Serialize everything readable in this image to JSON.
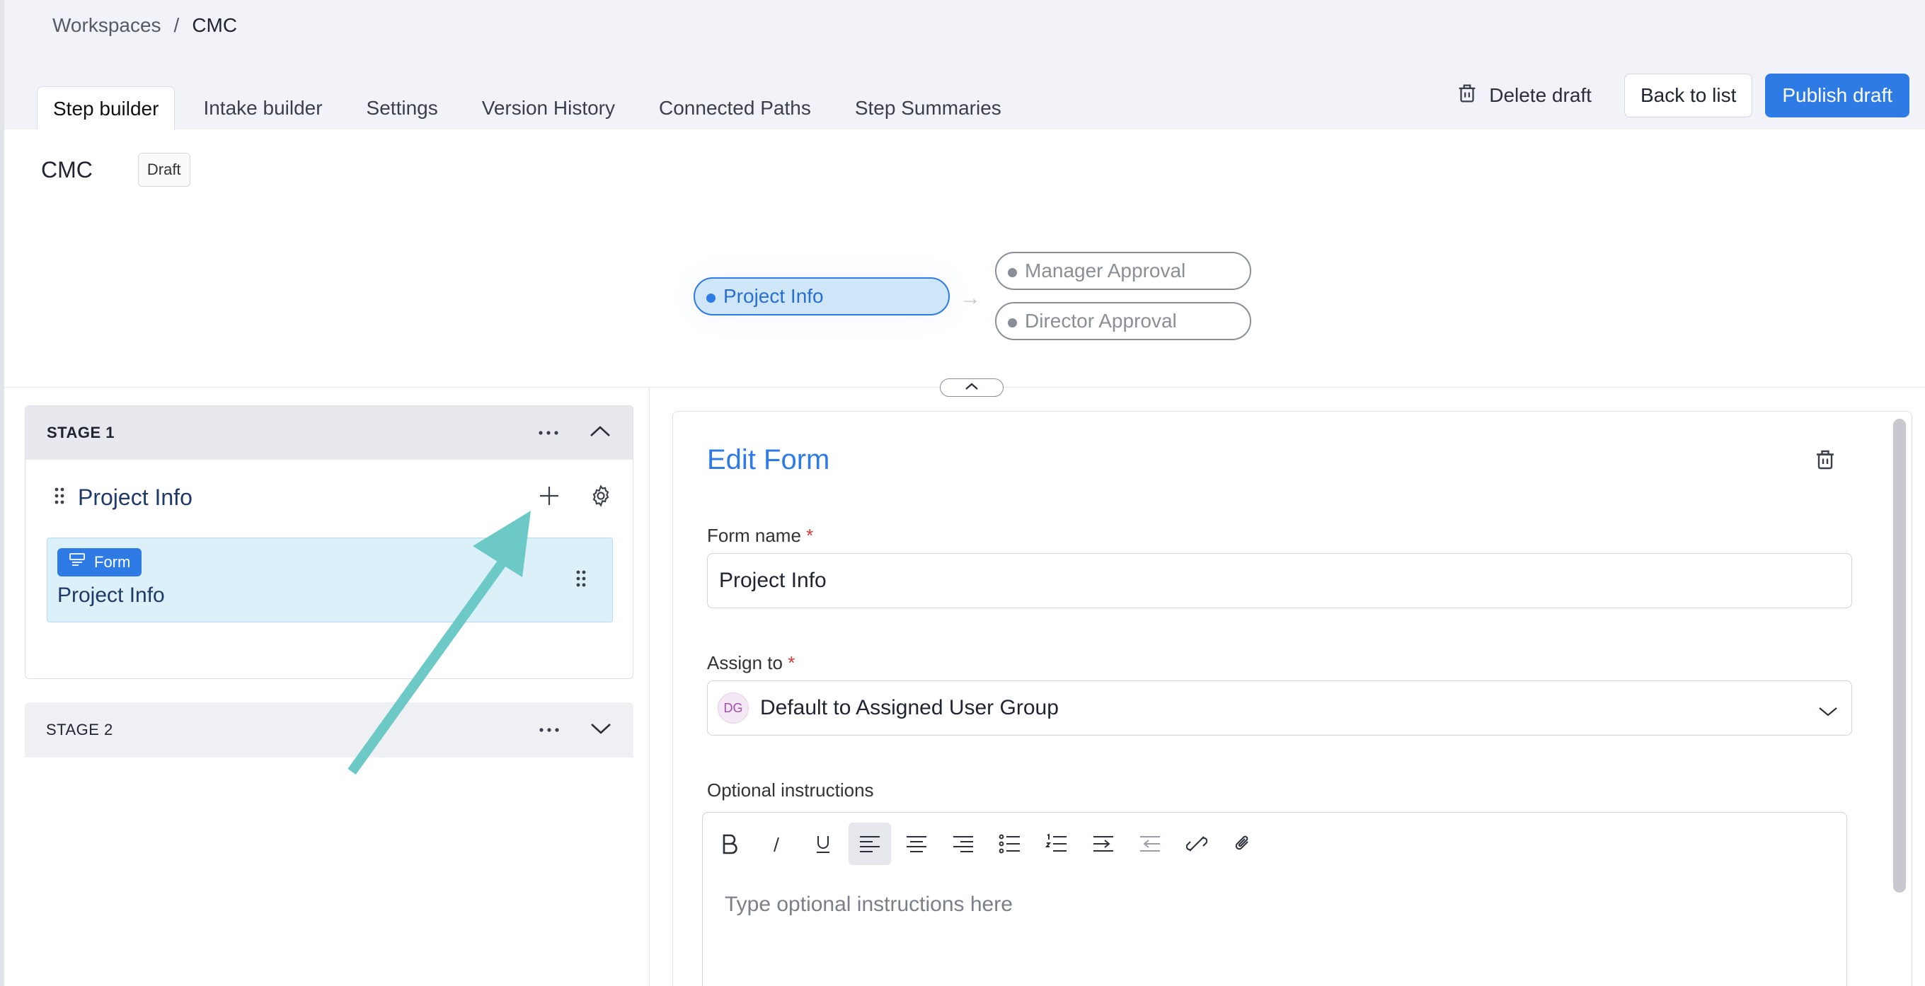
{
  "breadcrumb": {
    "root": "Workspaces",
    "separator": "/",
    "current": "CMC"
  },
  "tabs": [
    {
      "label": "Step builder",
      "active": true
    },
    {
      "label": "Intake builder",
      "active": false
    },
    {
      "label": "Settings",
      "active": false
    },
    {
      "label": "Version History",
      "active": false
    },
    {
      "label": "Connected Paths",
      "active": false
    },
    {
      "label": "Step Summaries",
      "active": false
    }
  ],
  "actions": {
    "delete_label": "Delete draft",
    "back_label": "Back to list",
    "publish_label": "Publish draft"
  },
  "page": {
    "title": "CMC",
    "badge": "Draft"
  },
  "flow": {
    "active_node": "Project Info",
    "next_nodes": [
      "Manager Approval",
      "Director Approval"
    ]
  },
  "stages": [
    {
      "label": "STAGE 1",
      "expanded": true,
      "step": {
        "name": "Project Info",
        "form_chip": "Form",
        "form_title": "Project Info"
      }
    },
    {
      "label": "STAGE 2",
      "expanded": false
    }
  ],
  "edit_form": {
    "title": "Edit Form",
    "form_name_label": "Form name",
    "form_name_value": "Project Info",
    "assign_label": "Assign to",
    "assign_avatar": "DG",
    "assign_value": "Default to Assigned User Group",
    "instructions_label": "Optional instructions",
    "instructions_placeholder": "Type optional instructions here",
    "required_mark": "*"
  },
  "colors": {
    "accent": "#2f7be5",
    "active_node_fill": "#cfe6f8",
    "form_card_fill": "#dcf0fa",
    "annotation_arrow": "#6cc9c6"
  }
}
